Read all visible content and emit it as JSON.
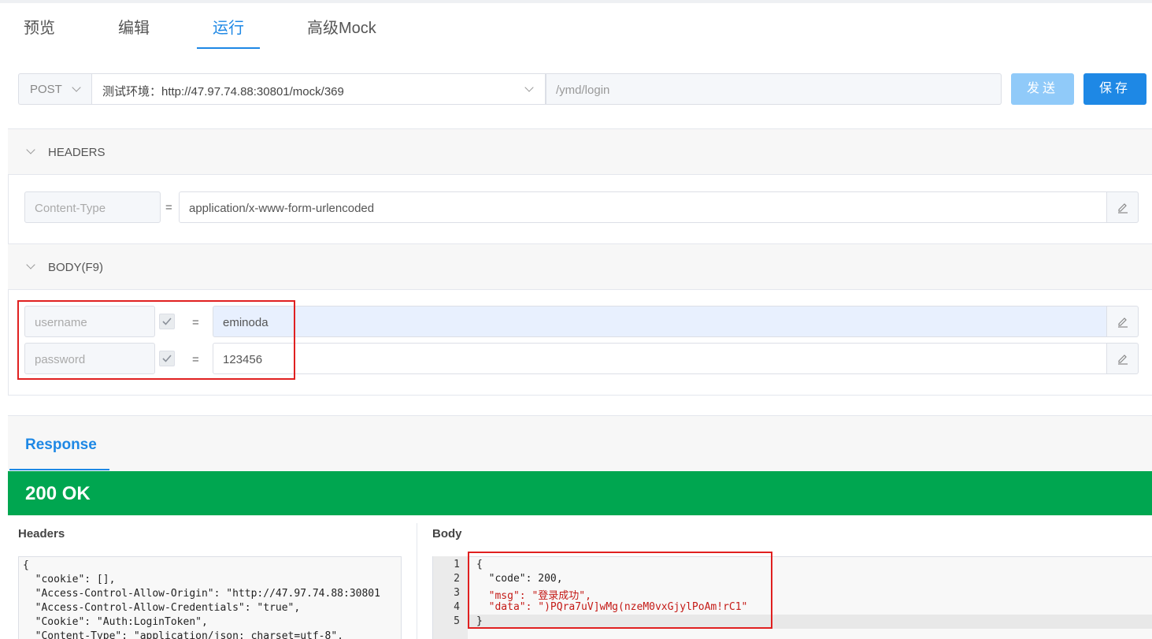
{
  "tabs": [
    "预览",
    "编辑",
    "运行",
    "高级Mock"
  ],
  "request": {
    "method": "POST",
    "env": "测试环境：http://47.97.74.88:30801/mock/369",
    "path": "/ymd/login",
    "send_label": "发送",
    "save_label": "保存"
  },
  "headers_section": {
    "title": "HEADERS",
    "key": "Content-Type",
    "eq": "=",
    "value": "application/x-www-form-urlencoded"
  },
  "body_section": {
    "title": "BODY(F9)",
    "rows": [
      {
        "key": "username",
        "eq": "=",
        "value": "eminoda"
      },
      {
        "key": "password",
        "eq": "=",
        "value": "123456"
      }
    ]
  },
  "response": {
    "tab": "Response",
    "status": "200 OK",
    "headers_label": "Headers",
    "body_label": "Body",
    "headers_lines": [
      "{",
      "  \"cookie\": [],",
      "  \"Access-Control-Allow-Origin\": \"http://47.97.74.88:30801",
      "  \"Access-Control-Allow-Credentials\": \"true\",",
      "  \"Cookie\": \"Auth:LoginToken\",",
      "  \"Content-Type\": \"application/json; charset=utf-8\","
    ],
    "line_numbers": [
      "1",
      "2",
      "3",
      "4",
      "5"
    ],
    "body_lines": [
      "{",
      "  \"code\": 200,",
      "  \"msg\": \"登录成功\",",
      "  \"data\": \")PQra7uV]wMg(nzeM0vxGjylPoAm!rC1\"",
      "}"
    ]
  },
  "colors": {
    "accent": "#1e88e5",
    "status_ok": "#00a650",
    "highlight_box": "#e02020"
  }
}
